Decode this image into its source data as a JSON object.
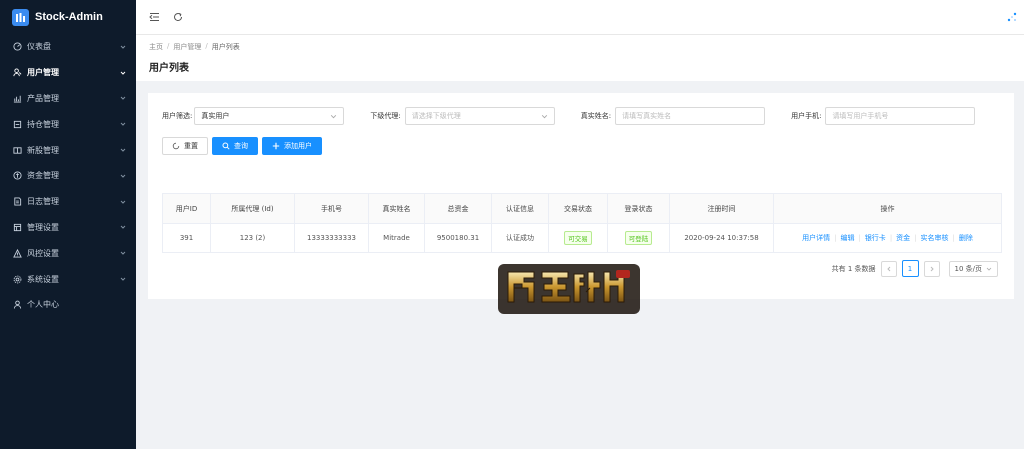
{
  "app": {
    "title": "Stock-Admin"
  },
  "sidebar": {
    "items": [
      {
        "label": "仪表盘",
        "icon": "dashboard-icon",
        "active": false
      },
      {
        "label": "用户管理",
        "icon": "users-icon",
        "active": true
      },
      {
        "label": "产品管理",
        "icon": "product-chart-icon",
        "active": false
      },
      {
        "label": "持仓管理",
        "icon": "position-icon",
        "active": false
      },
      {
        "label": "新股管理",
        "icon": "ipo-icon",
        "active": false
      },
      {
        "label": "资金管理",
        "icon": "funds-icon",
        "active": false
      },
      {
        "label": "日志管理",
        "icon": "log-icon",
        "active": false
      },
      {
        "label": "管理设置",
        "icon": "admin-settings-icon",
        "active": false
      },
      {
        "label": "风控设置",
        "icon": "risk-warning-icon",
        "active": false
      },
      {
        "label": "系统设置",
        "icon": "system-gear-icon",
        "active": false
      },
      {
        "label": "个人中心",
        "icon": "profile-icon",
        "active": false
      }
    ]
  },
  "breadcrumb": [
    "主页",
    "用户管理",
    "用户列表"
  ],
  "page": {
    "title": "用户列表"
  },
  "filters": {
    "user_filter": {
      "label": "用户筛选:",
      "value": "真实用户"
    },
    "agent": {
      "label": "下级代理:",
      "placeholder": "请选择下级代理"
    },
    "real_name": {
      "label": "真实姓名:",
      "placeholder": "请填写真实姓名"
    },
    "phone": {
      "label": "用户手机:",
      "placeholder": "请填写用户手机号"
    }
  },
  "buttons": {
    "reset": "重置",
    "search": "查询",
    "add_user": "添加用户"
  },
  "table": {
    "headers": [
      "用户ID",
      "所属代理 (Id)",
      "手机号",
      "真实姓名",
      "总资金",
      "认证信息",
      "交易状态",
      "登录状态",
      "注册时间",
      "操作"
    ],
    "rows": [
      {
        "id": "391",
        "agent": "123 (2)",
        "phone": "13333333333",
        "name": "Mitrade",
        "funds": "9500180.31",
        "auth": "认证成功",
        "trade_status": "可交易",
        "login_status": "可登陆",
        "reg_time": "2020-09-24 10:37:58",
        "ops": [
          "用户详情",
          "编辑",
          "银行卡",
          "资金",
          "实名审核",
          "删除"
        ]
      }
    ]
  },
  "pagination": {
    "total_text": "共有 1 条数据",
    "current_page": "1",
    "page_size": "10 条/页"
  },
  "colors": {
    "sidebar": "#0e1b2b",
    "primary": "#1890ff",
    "success": "#52c41a"
  }
}
